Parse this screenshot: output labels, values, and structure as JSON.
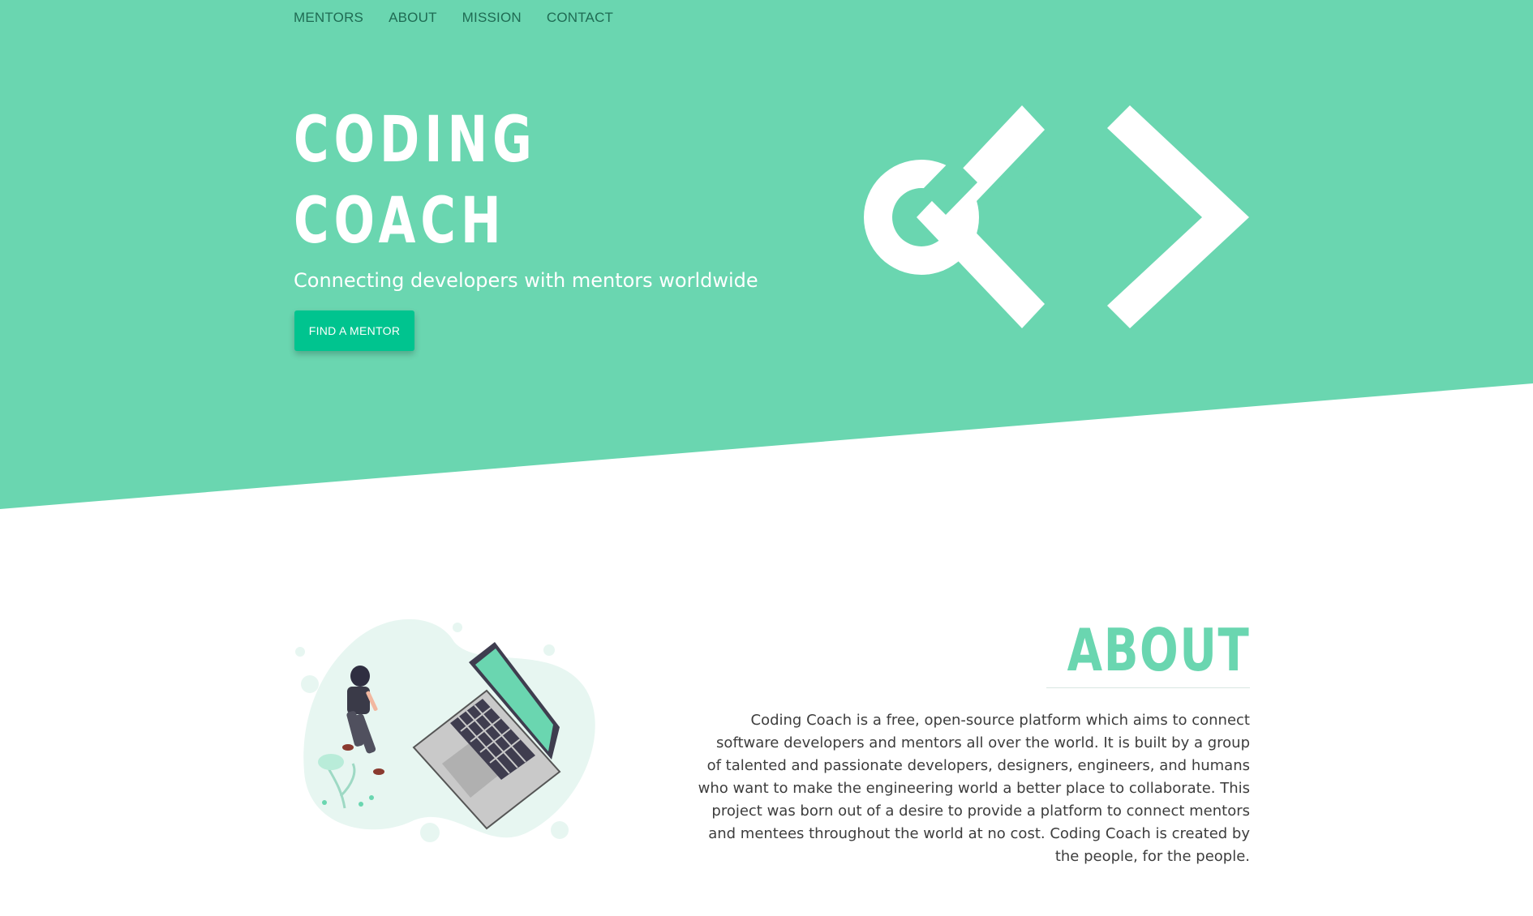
{
  "nav": {
    "items": [
      {
        "label": "MENTORS"
      },
      {
        "label": "ABOUT"
      },
      {
        "label": "MISSION"
      },
      {
        "label": "CONTACT"
      }
    ]
  },
  "hero": {
    "title_line1": "CODING",
    "title_line2": "COACH",
    "subtitle": "Connecting developers with mentors worldwide",
    "cta_label": "FIND A MENTOR",
    "logo_icon": "coding-coach-logo-icon"
  },
  "about": {
    "title": "ABOUT",
    "text": "Coding Coach is a free, open-source platform which aims to connect software developers and mentors all over the world. It is built by a group of talented and passionate developers, designers, engineers, and humans who want to make the engineering world a better place to collaborate. This project was born out of a desire to provide a platform to connect mentors and mentees throughout the world at no cost. Coding Coach is created by the people, for the people.",
    "illustration_icon": "person-laptop-illustration"
  },
  "colors": {
    "brand": "#6ad6b0",
    "cta": "#00c48f",
    "nav_text": "#1f6b53",
    "body_text": "#3d3d3d"
  }
}
